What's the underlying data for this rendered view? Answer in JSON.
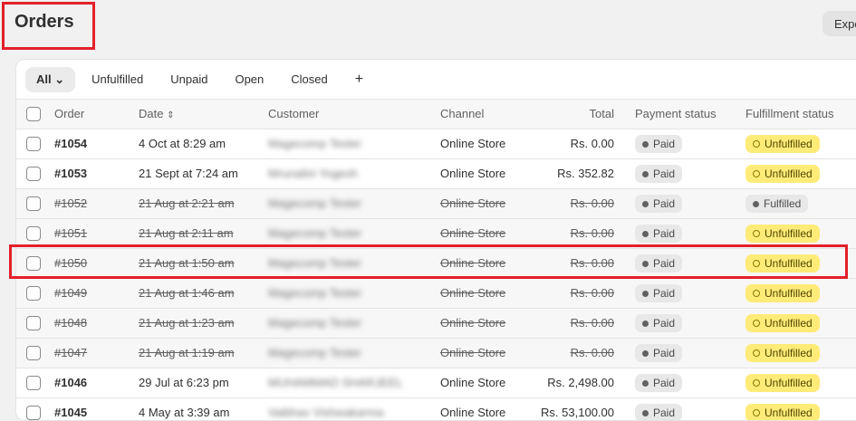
{
  "page": {
    "title": "Orders",
    "export_label": "Expo"
  },
  "tabs": [
    "All",
    "Unfulfilled",
    "Unpaid",
    "Open",
    "Closed",
    "+"
  ],
  "columns": {
    "order": "Order",
    "date": "Date",
    "customer": "Customer",
    "channel": "Channel",
    "total": "Total",
    "payment": "Payment status",
    "fulfillment": "Fulfillment status"
  },
  "rows": [
    {
      "order": "#1054",
      "date": "4 Oct at 8:29 am",
      "customer": "Magecomp Tester",
      "channel": "Online Store",
      "total": "Rs. 0.00",
      "payment": "Paid",
      "fulfillment": "Unfulfilled",
      "cancelled": false
    },
    {
      "order": "#1053",
      "date": "21 Sept at 7:24 am",
      "customer": "Mrunalini Yogesh",
      "channel": "Online Store",
      "total": "Rs. 352.82",
      "payment": "Paid",
      "fulfillment": "Unfulfilled",
      "cancelled": false
    },
    {
      "order": "#1052",
      "date": "21 Aug at 2:21 am",
      "customer": "Magecomp Tester",
      "channel": "Online Store",
      "total": "Rs. 0.00",
      "payment": "Paid",
      "fulfillment": "Fulfilled",
      "cancelled": true
    },
    {
      "order": "#1051",
      "date": "21 Aug at 2:11 am",
      "customer": "Magecomp Tester",
      "channel": "Online Store",
      "total": "Rs. 0.00",
      "payment": "Paid",
      "fulfillment": "Unfulfilled",
      "cancelled": true
    },
    {
      "order": "#1050",
      "date": "21 Aug at 1:50 am",
      "customer": "Magecomp Tester",
      "channel": "Online Store",
      "total": "Rs. 0.00",
      "payment": "Paid",
      "fulfillment": "Unfulfilled",
      "cancelled": true
    },
    {
      "order": "#1049",
      "date": "21 Aug at 1:46 am",
      "customer": "Magecomp Tester",
      "channel": "Online Store",
      "total": "Rs. 0.00",
      "payment": "Paid",
      "fulfillment": "Unfulfilled",
      "cancelled": true
    },
    {
      "order": "#1048",
      "date": "21 Aug at 1:23 am",
      "customer": "Magecomp Tester",
      "channel": "Online Store",
      "total": "Rs. 0.00",
      "payment": "Paid",
      "fulfillment": "Unfulfilled",
      "cancelled": true
    },
    {
      "order": "#1047",
      "date": "21 Aug at 1:19 am",
      "customer": "Magecomp Tester",
      "channel": "Online Store",
      "total": "Rs. 0.00",
      "payment": "Paid",
      "fulfillment": "Unfulfilled",
      "cancelled": true
    },
    {
      "order": "#1046",
      "date": "29 Jul at 6:23 pm",
      "customer": "MUHAMMAD SHARJEEL",
      "channel": "Online Store",
      "total": "Rs. 2,498.00",
      "payment": "Paid",
      "fulfillment": "Unfulfilled",
      "cancelled": false
    },
    {
      "order": "#1045",
      "date": "4 May at 3:39 am",
      "customer": "Vaibhav Vishwakarma",
      "channel": "Online Store",
      "total": "Rs. 53,100.00",
      "payment": "Paid",
      "fulfillment": "Unfulfilled",
      "cancelled": false
    }
  ],
  "colors": {
    "highlight": "#e3202a",
    "unfulfilled_bg": "#ffeb78",
    "paid_bg": "#e8e8e8"
  }
}
